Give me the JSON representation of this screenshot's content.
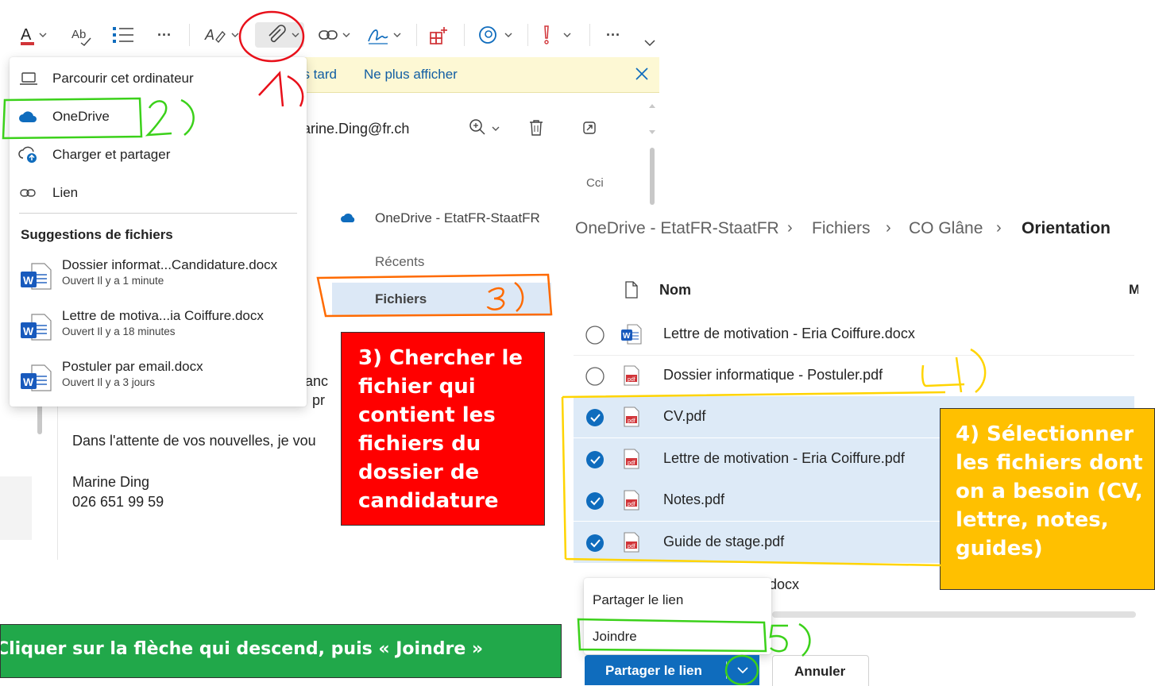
{
  "composer": {
    "infobar": {
      "later": "us tard",
      "dont_show": "Ne plus afficher"
    },
    "recipient": "arine.Ding@fr.ch",
    "cci": "Cci",
    "body": {
      "line1_partial": "anc",
      "line2_partial": "pr",
      "closing": "Dans l'attente de vos nouvelles, je vou",
      "signature_name": "Marine Ding",
      "signature_phone": "026 651 99 59"
    }
  },
  "attach_menu": {
    "items": [
      {
        "label": "Parcourir cet ordinateur",
        "icon": "laptop-icon"
      },
      {
        "label": "OneDrive",
        "icon": "onedrive-cloud-icon"
      },
      {
        "label": "Charger et partager",
        "icon": "cloud-upload-icon"
      },
      {
        "label": "Lien",
        "icon": "link-icon"
      }
    ],
    "suggestions_title": "Suggestions de fichiers",
    "suggestions": [
      {
        "name": "Dossier informat...Candidature.docx",
        "opened": "Ouvert Il y a 1 minute"
      },
      {
        "name": "Lettre de motiva...ia Coiffure.docx",
        "opened": "Ouvert Il y a 18 minutes"
      },
      {
        "name": "Postuler par email.docx",
        "opened": "Ouvert Il y a 3 jours"
      }
    ]
  },
  "picker": {
    "nav": {
      "account": "OneDrive - EtatFR-StaatFR",
      "recents": "Récents",
      "files": "Fichiers"
    },
    "breadcrumb": [
      "OneDrive - EtatFR-StaatFR",
      "Fichiers",
      "CO Glâne",
      "Orientation"
    ],
    "column_name": "Nom",
    "column_partial": "M",
    "files": [
      {
        "name": "Lettre de motivation - Eria Coiffure.docx",
        "type": "docx",
        "selected": false
      },
      {
        "name": "Dossier informatique - Postuler.pdf",
        "type": "pdf",
        "selected": false
      },
      {
        "name": "CV.pdf",
        "type": "pdf",
        "selected": true
      },
      {
        "name": "Lettre de motivation - Eria Coiffure.pdf",
        "type": "pdf",
        "selected": true
      },
      {
        "name": "Notes.pdf",
        "type": "pdf",
        "selected": true
      },
      {
        "name": "Guide de stage.pdf",
        "type": "pdf",
        "selected": true
      }
    ],
    "partial_row": "docx",
    "share_menu": {
      "share_link": "Partager le lien",
      "attach": "Joindre"
    },
    "buttons": {
      "share": "Partager le lien",
      "cancel": "Annuler"
    }
  },
  "annotations": {
    "step3": "3) Chercher le fichier qui contient les fichiers du dossier de candidature",
    "step4": "4) Sélectionner les fichiers dont on a besoin (CV, lettre, notes, guides)",
    "step5": "Cliquer sur la flèche qui descend, puis « Joindre »"
  },
  "colors": {
    "accent": "#0f6cbd",
    "selected_row": "#ddeaf7",
    "note3": "#ff0000",
    "note4": "#ffc000",
    "note5": "#21a84a"
  }
}
